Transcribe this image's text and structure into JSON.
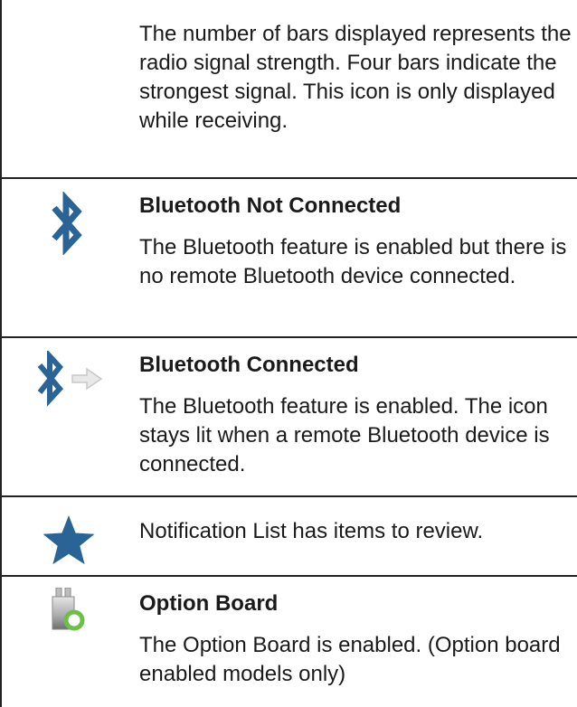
{
  "rows": [
    {
      "title": "",
      "text": "The number of bars displayed represents the radio signal strength. Four bars indicate the strongest signal. This icon is only displayed while receiving."
    },
    {
      "title": "Bluetooth Not Connected",
      "text": "The Bluetooth feature is enabled but there is no remote Bluetooth device connected.",
      "icon": "bluetooth-icon"
    },
    {
      "title": "Bluetooth Connected",
      "text": "The Bluetooth feature is enabled. The icon stays lit when a remote Bluetooth device is connected.",
      "icon": "bluetooth-connected-icon"
    },
    {
      "title": "",
      "text": "Notification List has items to review.",
      "icon": "star-icon"
    },
    {
      "title": "Option Board",
      "text": "The Option Board is enabled. (Option board enabled models only)",
      "icon": "option-board-icon"
    }
  ],
  "colors": {
    "icon_blue": "#2a6496",
    "arrow_grey": "#d0d0d0",
    "option_green": "#6cc04a",
    "rule": "#222222"
  }
}
